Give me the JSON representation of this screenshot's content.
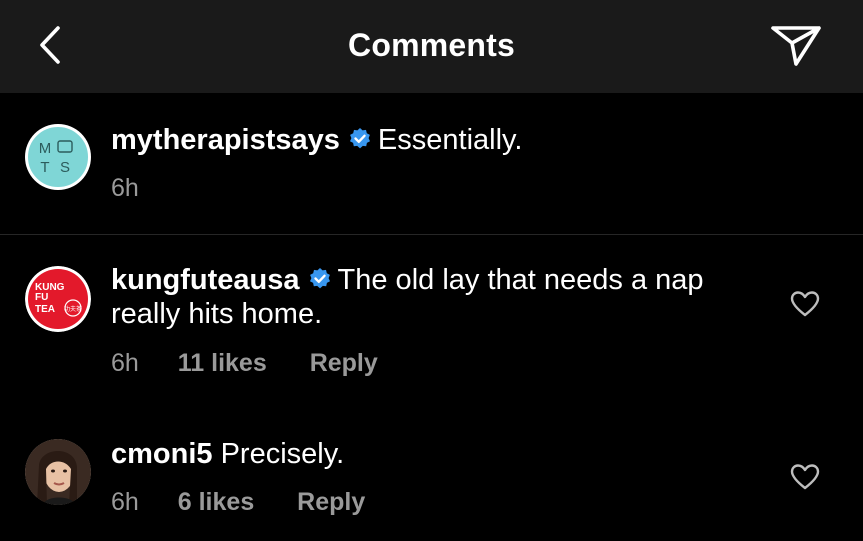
{
  "header": {
    "title": "Comments"
  },
  "comments": [
    {
      "username": "mytherapistsays",
      "verified": true,
      "text": "Essentially.",
      "time": "6h",
      "avatar_icon": "mts-logo",
      "avatar_text": [
        "M",
        "T",
        "S"
      ]
    },
    {
      "username": "kungfuteausa",
      "verified": true,
      "text_line1": "The old lay that needs a nap",
      "text_line2": "really hits home.",
      "time": "6h",
      "likes": "11 likes",
      "reply": "Reply",
      "avatar_icon": "kung-fu-tea-logo",
      "avatar_text": [
        "KUNG",
        "FU",
        "TEA",
        "功夫茶"
      ]
    },
    {
      "username": "cmoni5",
      "verified": false,
      "text": "Precisely.",
      "time": "6h",
      "likes": "6 likes",
      "reply": "Reply",
      "avatar_icon": "user-photo"
    }
  ],
  "colors": {
    "background": "#000000",
    "header": "#1a1a1a",
    "verified": "#3897f0",
    "secondary_text": "#9a9a9a",
    "kungfu_red": "#e3192b",
    "mts_teal": "#7fd6d6"
  }
}
